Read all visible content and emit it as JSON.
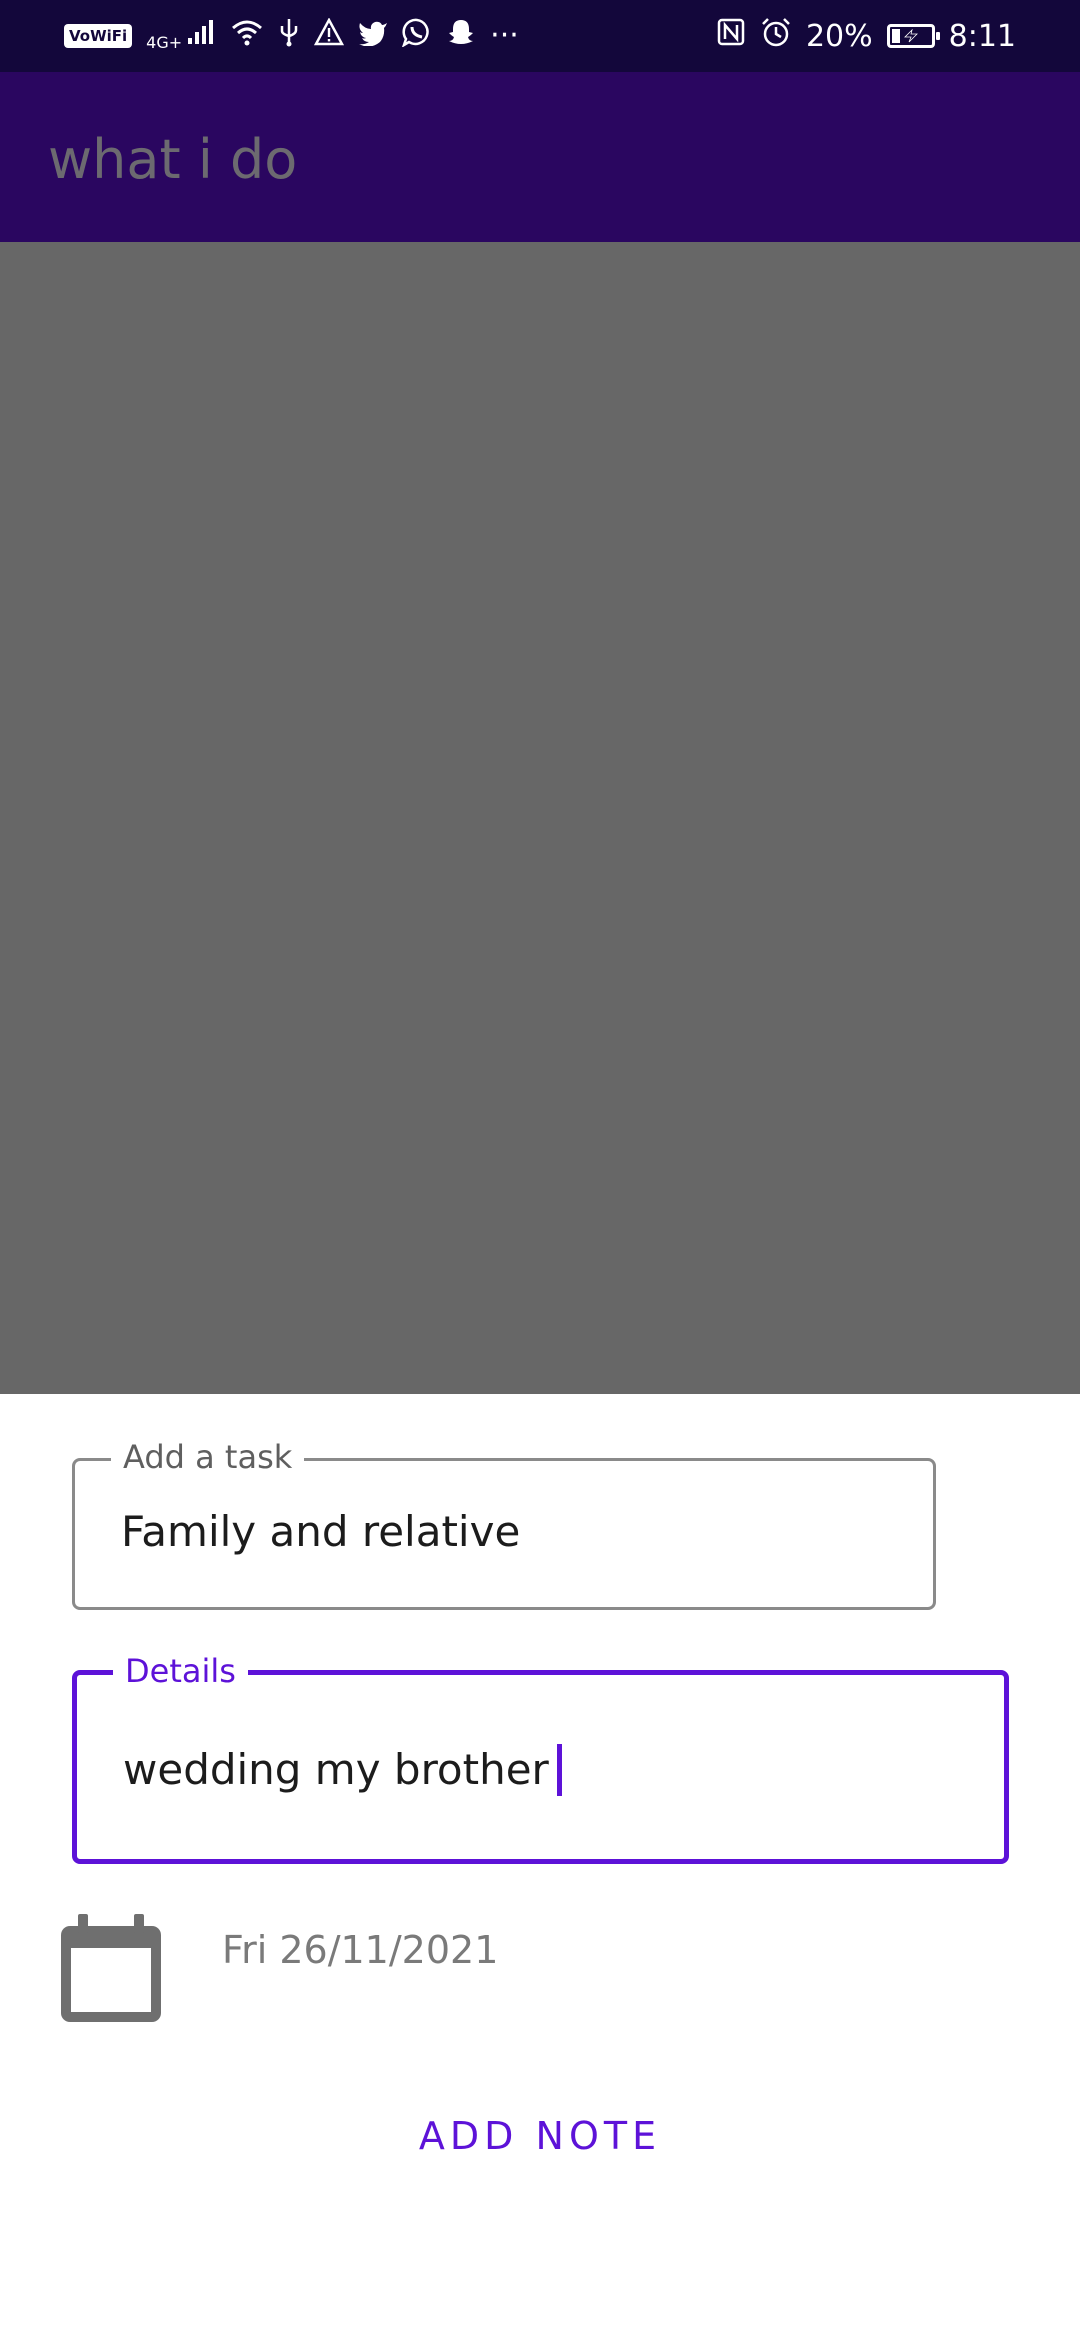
{
  "status_bar": {
    "wifi_badge": "VoWiFi",
    "network": "4G+",
    "more": "···",
    "battery": "20%",
    "battery_level": 0.2,
    "time": "8:11",
    "icons": [
      "signal-icon",
      "wifi-icon",
      "usb-icon",
      "warning-icon",
      "twitter-icon",
      "whatsapp-icon",
      "snapchat-icon",
      "nfc-icon",
      "alarm-icon",
      "battery-charging-icon"
    ]
  },
  "app_bar": {
    "title": "what i do"
  },
  "form": {
    "task": {
      "label": "Add a task",
      "value": "Family and relative"
    },
    "details": {
      "label": "Details",
      "value": "wedding my brother"
    },
    "date": {
      "value": "Fri 26/11/2021",
      "icon": "calendar-icon"
    },
    "submit_label": "ADD NOTE"
  },
  "colors": {
    "status_bar_bg": "#13073b",
    "app_bar_bg": "#2a0660",
    "accent": "#5d12d8",
    "scrim": "#676767"
  }
}
